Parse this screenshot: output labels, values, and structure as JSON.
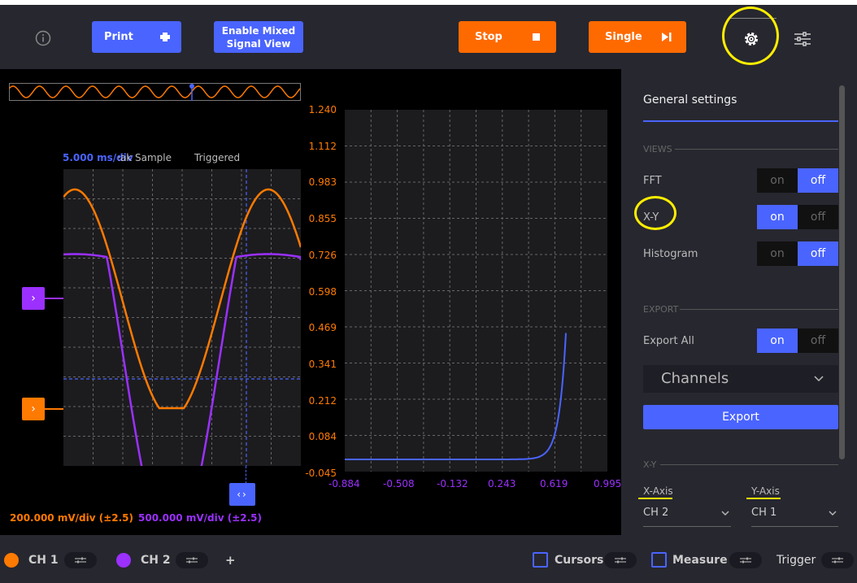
{
  "toolbar": {
    "print_label": "Print",
    "mixed_label_line1": "Enable Mixed",
    "mixed_label_line2": "Signal View",
    "stop_label": "Stop",
    "single_label": "Single"
  },
  "scope": {
    "timebase": "5.000 ms/div",
    "sample_mode": "Peak Sample",
    "trigger_status": "Triggered",
    "ch1_scale": "200.000 mV/div (±2.5)",
    "ch2_scale": "500.000 mV/div (±2.5)"
  },
  "xy_plot": {
    "y_ticks": [
      "1.240",
      "1.112",
      "0.983",
      "0.855",
      "0.726",
      "0.598",
      "0.469",
      "0.341",
      "0.212",
      "0.084",
      "-0.045"
    ],
    "x_ticks": [
      "-0.884",
      "-0.508",
      "-0.132",
      "0.243",
      "0.619",
      "0.995"
    ]
  },
  "settings": {
    "title": "General settings",
    "views_section": "VIEWS",
    "fft_label": "FFT",
    "xy_label": "X-Y",
    "histogram_label": "Histogram",
    "on": "on",
    "off": "off",
    "export_section": "EXPORT",
    "export_all_label": "Export All",
    "channels_dropdown": "Channels",
    "export_button": "Export",
    "xy_section": "X-Y",
    "x_axis_label": "X-Axis",
    "y_axis_label": "Y-Axis",
    "x_axis_value": "CH 2",
    "y_axis_value": "CH 1"
  },
  "bottom": {
    "ch1_label": "CH 1",
    "ch2_label": "CH 2",
    "add_label": "+",
    "cursors_label": "Cursors",
    "measure_label": "Measure",
    "trigger_label": "Trigger"
  },
  "colors": {
    "ch1": "#ff7a00",
    "ch2": "#9b30ff",
    "accent": "#4a64ff",
    "highlight": "#ffee00"
  }
}
